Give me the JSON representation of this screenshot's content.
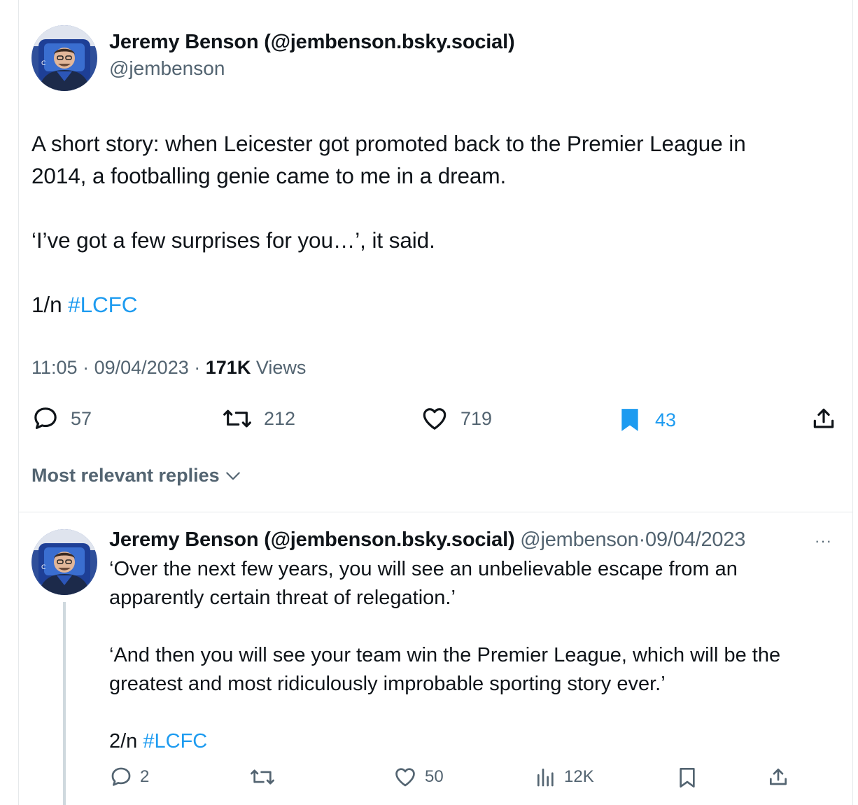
{
  "main_tweet": {
    "display_name": "Jeremy Benson (@jembenson.bsky.social)",
    "handle": "@jembenson",
    "text_lines": [
      "A short story: when Leicester got promoted back to the Premier League in",
      "2014, a footballing genie came to me in a dream."
    ],
    "quote_line": "‘I’ve got a few surprises for you…’, it said.",
    "thread_marker": "1/n",
    "hashtag": "#LCFC",
    "time": "11:05",
    "date": "09/04/2023",
    "views_count": "171K",
    "views_label": "Views",
    "separator": "·",
    "replies": "57",
    "reposts": "212",
    "likes": "719",
    "bookmarks": "43",
    "bookmarked": true
  },
  "replies_filter": {
    "label": "Most relevant replies"
  },
  "reply_tweet": {
    "display_name": "Jeremy Benson (@jembenson.bsky.social)",
    "handle": "@jembenson",
    "separator": "·",
    "date": "09/04/2023",
    "more": "···",
    "paragraph1": [
      "‘Over the next few years, you will see an unbelievable escape from an",
      "apparently certain threat of relegation.’"
    ],
    "paragraph2": [
      "‘And then you will see your team win the Premier League, which will be the",
      "greatest and most ridiculously improbable sporting story ever.’"
    ],
    "thread_marker": "2/n",
    "hashtag": "#LCFC",
    "replies": "2",
    "likes": "50",
    "views": "12K"
  },
  "icons": {
    "reply": "speech-bubble-icon",
    "repost": "repost-arrows-icon",
    "like": "heart-icon",
    "bookmark": "bookmark-icon",
    "share": "share-upload-icon",
    "views": "bar-chart-icon",
    "chevron": "chevron-down-icon",
    "more": "ellipsis-icon"
  },
  "colors": {
    "accent": "#1d9bf0",
    "secondary_text": "#536471",
    "text": "#0f1419",
    "thread_line": "#cfd9de"
  }
}
